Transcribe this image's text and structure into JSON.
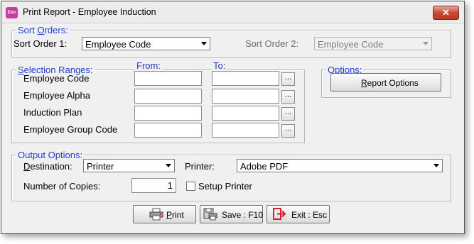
{
  "window": {
    "title": "Print Report - Employee Induction",
    "app_icon_text": "Exo",
    "close_glyph": "✕"
  },
  "sort_orders": {
    "legend_prefix": "Sort ",
    "legend_accel": "O",
    "legend_suffix": "rders:",
    "sort1_label": "Sort Order 1:",
    "sort1_value": "Employee Code",
    "sort2_label": "Sort Order 2:",
    "sort2_value": "Employee Code"
  },
  "selection": {
    "legend_accel": "S",
    "legend_suffix": "election Ranges:",
    "from_label": "From:",
    "to_label": "To:",
    "ellipsis": "...",
    "rows": [
      {
        "label": "Employee Code",
        "from": "",
        "to": ""
      },
      {
        "label": "Employee Alpha",
        "from": "",
        "to": ""
      },
      {
        "label": "Induction Plan",
        "from": "",
        "to": ""
      },
      {
        "label": "Employee Group Code",
        "from": "",
        "to": ""
      }
    ]
  },
  "options": {
    "legend": "Options:",
    "report_options_accel": "R",
    "report_options_suffix": "eport Options"
  },
  "output": {
    "legend": "Output Options:",
    "destination_accel": "D",
    "destination_suffix": "estination:",
    "destination_value": "Printer",
    "printer_label": "Printer:",
    "printer_value": "Adobe PDF",
    "copies_label": "Number of Copies:",
    "copies_value": "1",
    "setup_printer_label": "Setup Printer",
    "setup_printer_checked": false
  },
  "buttons": {
    "print_accel": "P",
    "print_suffix": "rint",
    "save_label": "Save : F10",
    "exit_label": "Exit : Esc"
  },
  "colors": {
    "legend_text": "#1f3ec8",
    "exit_icon": "#d42020",
    "close_button": "#c94a32"
  },
  "icons": {
    "print": "printer-icon",
    "save": "floppy-printer-icon",
    "exit": "exit-door-icon",
    "dropdown": "chevron-down-icon"
  }
}
